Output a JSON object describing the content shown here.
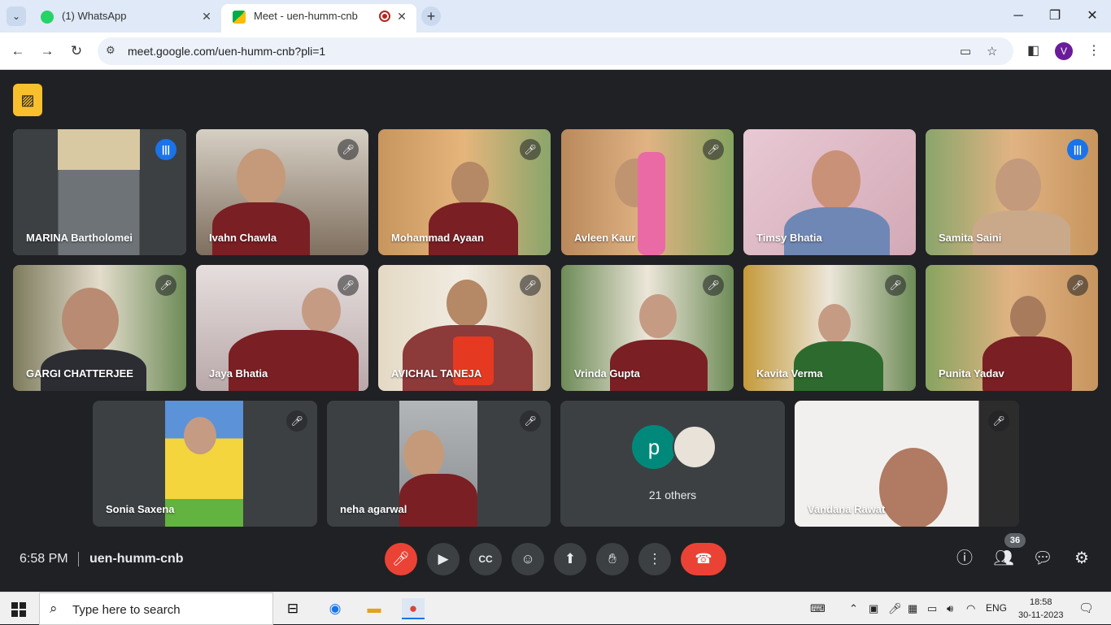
{
  "browser": {
    "tabs": [
      {
        "title": "(1) WhatsApp"
      },
      {
        "title": "Meet - uen-humm-cnb"
      }
    ],
    "url": "meet.google.com/uen-humm-cnb?pli=1",
    "profile_initial": "V"
  },
  "meet": {
    "participants": [
      {
        "name": "MARINA Bartholomei",
        "speaking": true
      },
      {
        "name": "Ivahn Chawla",
        "speaking": false
      },
      {
        "name": "Mohammad Ayaan",
        "speaking": false
      },
      {
        "name": "Avleen Kaur",
        "speaking": false
      },
      {
        "name": "Timsy Bhatia",
        "speaking": false
      },
      {
        "name": "Samita Saini",
        "speaking": true
      },
      {
        "name": "GARGI CHATTERJEE",
        "speaking": false
      },
      {
        "name": "Jaya Bhatia",
        "speaking": false
      },
      {
        "name": "AVICHAL TANEJA",
        "speaking": false
      },
      {
        "name": "Vrinda Gupta",
        "speaking": false
      },
      {
        "name": "Kavita Verma",
        "speaking": false
      },
      {
        "name": "Punita Yadav",
        "speaking": false
      },
      {
        "name": "Sonia Saxena",
        "speaking": false
      },
      {
        "name": "neha agarwal",
        "speaking": false
      },
      {
        "name": "Vandana Rawat",
        "speaking": false
      }
    ],
    "others": {
      "label": "21 others",
      "avatar_letter": "p"
    },
    "time": "6:58 PM",
    "meeting_code": "uen-humm-cnb",
    "people_count": "36"
  },
  "taskbar": {
    "search_placeholder": "Type here to search",
    "lang": "ENG",
    "time": "18:58",
    "date": "30-11-2023"
  },
  "colors": {
    "accent": "#1a73e8",
    "end_call": "#ea4335",
    "warning_badge": "#f9c02d"
  }
}
